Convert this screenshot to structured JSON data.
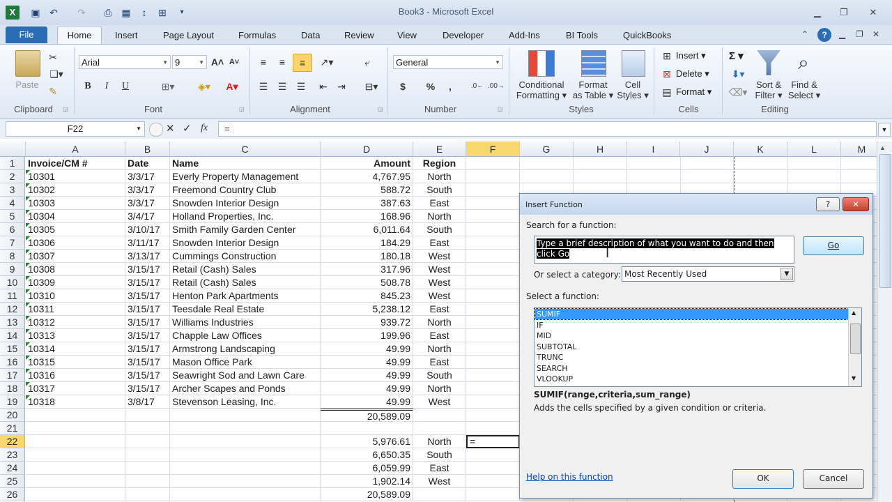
{
  "window": {
    "title": "Book3  -  Microsoft Excel"
  },
  "tabs": [
    "File",
    "Home",
    "Insert",
    "Page Layout",
    "Formulas",
    "Data",
    "Review",
    "View",
    "Developer",
    "Add-Ins",
    "BI Tools",
    "QuickBooks"
  ],
  "ribbon": {
    "clipboard": {
      "label": "Clipboard",
      "paste": "Paste"
    },
    "font": {
      "label": "Font",
      "font_name": "Arial",
      "font_size": "9",
      "bold": "B",
      "italic": "I",
      "underline": "U"
    },
    "alignment": {
      "label": "Alignment"
    },
    "number": {
      "label": "Number",
      "format": "General",
      "currency": "$",
      "percent": "%",
      "comma": ","
    },
    "styles": {
      "label": "Styles",
      "conditional": [
        "Conditional",
        "Formatting ▾"
      ],
      "format_table": [
        "Format",
        "as Table ▾"
      ],
      "cell_styles": [
        "Cell",
        "Styles ▾"
      ]
    },
    "cells": {
      "label": "Cells",
      "insert": "Insert ▾",
      "delete": "Delete ▾",
      "format": "Format ▾"
    },
    "editing": {
      "label": "Editing",
      "sort": [
        "Sort &",
        "Filter ▾"
      ],
      "find": [
        "Find &",
        "Select ▾"
      ],
      "sum": "Σ ▾"
    }
  },
  "formula_bar": {
    "name_box": "F22",
    "fx": "fx",
    "content": "="
  },
  "columns": [
    "A",
    "B",
    "C",
    "D",
    "E",
    "F",
    "G",
    "H",
    "I",
    "J",
    "K",
    "L",
    "M"
  ],
  "header_row": {
    "a": "Invoice/CM #",
    "b": "Date",
    "c": "Name",
    "d": "Amount",
    "e": "Region"
  },
  "rows": [
    {
      "n": "2",
      "a": "10301",
      "b": "3/3/17",
      "c": "Everly Property Management",
      "d": "4,767.95",
      "e": "North"
    },
    {
      "n": "3",
      "a": "10302",
      "b": "3/3/17",
      "c": "Freemond Country Club",
      "d": "588.72",
      "e": "South"
    },
    {
      "n": "4",
      "a": "10303",
      "b": "3/3/17",
      "c": "Snowden Interior Design",
      "d": "387.63",
      "e": "East"
    },
    {
      "n": "5",
      "a": "10304",
      "b": "3/4/17",
      "c": "Holland Properties, Inc.",
      "d": "168.96",
      "e": "North"
    },
    {
      "n": "6",
      "a": "10305",
      "b": "3/10/17",
      "c": "Smith Family Garden Center",
      "d": "6,011.64",
      "e": "South"
    },
    {
      "n": "7",
      "a": "10306",
      "b": "3/11/17",
      "c": "Snowden Interior Design",
      "d": "184.29",
      "e": "East"
    },
    {
      "n": "8",
      "a": "10307",
      "b": "3/13/17",
      "c": "Cummings Construction",
      "d": "180.18",
      "e": "West"
    },
    {
      "n": "9",
      "a": "10308",
      "b": "3/15/17",
      "c": "Retail (Cash) Sales",
      "d": "317.96",
      "e": "West"
    },
    {
      "n": "10",
      "a": "10309",
      "b": "3/15/17",
      "c": "Retail (Cash) Sales",
      "d": "508.78",
      "e": "West"
    },
    {
      "n": "11",
      "a": "10310",
      "b": "3/15/17",
      "c": "Henton Park Apartments",
      "d": "845.23",
      "e": "West"
    },
    {
      "n": "12",
      "a": "10311",
      "b": "3/15/17",
      "c": "Teesdale Real Estate",
      "d": "5,238.12",
      "e": "East"
    },
    {
      "n": "13",
      "a": "10312",
      "b": "3/15/17",
      "c": "Williams Industries",
      "d": "939.72",
      "e": "North"
    },
    {
      "n": "14",
      "a": "10313",
      "b": "3/15/17",
      "c": "Chapple Law Offices",
      "d": "199.96",
      "e": "East"
    },
    {
      "n": "15",
      "a": "10314",
      "b": "3/15/17",
      "c": "Armstrong Landscaping",
      "d": "49.99",
      "e": "North"
    },
    {
      "n": "16",
      "a": "10315",
      "b": "3/15/17",
      "c": "Mason Office Park",
      "d": "49.99",
      "e": "East"
    },
    {
      "n": "17",
      "a": "10316",
      "b": "3/15/17",
      "c": "Seawright Sod and Lawn Care",
      "d": "49.99",
      "e": "South"
    },
    {
      "n": "18",
      "a": "10317",
      "b": "3/15/17",
      "c": "Archer Scapes and Ponds",
      "d": "49.99",
      "e": "North"
    },
    {
      "n": "19",
      "a": "10318",
      "b": "3/8/17",
      "c": "Stevenson Leasing, Inc.",
      "d": "49.99",
      "e": "West"
    },
    {
      "n": "20",
      "a": "",
      "b": "",
      "c": "",
      "d": "20,589.09",
      "e": ""
    },
    {
      "n": "21",
      "a": "",
      "b": "",
      "c": "",
      "d": "",
      "e": ""
    },
    {
      "n": "22",
      "a": "",
      "b": "",
      "c": "",
      "d": "5,976.61",
      "e": "North",
      "f": "="
    },
    {
      "n": "23",
      "a": "",
      "b": "",
      "c": "",
      "d": "6,650.35",
      "e": "South"
    },
    {
      "n": "24",
      "a": "",
      "b": "",
      "c": "",
      "d": "6,059.99",
      "e": "East"
    },
    {
      "n": "25",
      "a": "",
      "b": "",
      "c": "",
      "d": "1,902.14",
      "e": "West"
    },
    {
      "n": "26",
      "a": "",
      "b": "",
      "c": "",
      "d": "20,589.09",
      "e": ""
    }
  ],
  "dialog": {
    "title": "Insert Function",
    "search_label": "Search for a function:",
    "search_value": "Type a brief description of what you want to do and then click Go",
    "go": "Go",
    "category_label": "Or select a category:",
    "category_value": "Most Recently Used",
    "select_label": "Select a function:",
    "functions": [
      "SUMIF",
      "IF",
      "MID",
      "SUBTOTAL",
      "TRUNC",
      "SEARCH",
      "VLOOKUP"
    ],
    "selected_function": "SUMIF",
    "signature": "SUMIF(range,criteria,sum_range)",
    "description": "Adds the cells specified by a given condition or criteria.",
    "help_link": "Help on this function",
    "ok": "OK",
    "cancel": "Cancel",
    "help_btn": "?",
    "close_btn": "✕"
  },
  "colors": {
    "selected_header": "#f8d86c",
    "file_tab": "#2a6db5",
    "list_selection": "#3399ff",
    "link": "#0645ad"
  }
}
